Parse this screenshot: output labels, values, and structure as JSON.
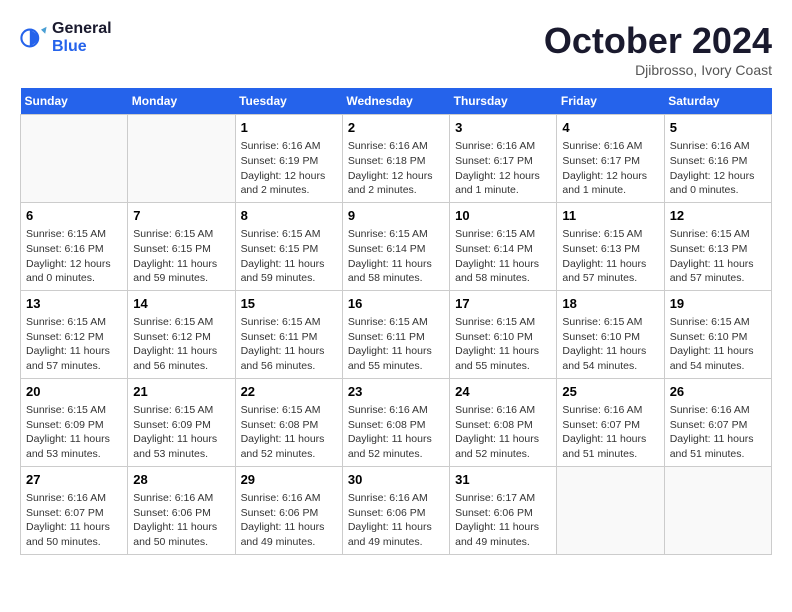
{
  "header": {
    "logo_line1": "General",
    "logo_line2": "Blue",
    "month": "October 2024",
    "location": "Djibrosso, Ivory Coast"
  },
  "days_of_week": [
    "Sunday",
    "Monday",
    "Tuesday",
    "Wednesday",
    "Thursday",
    "Friday",
    "Saturday"
  ],
  "weeks": [
    [
      {
        "day": "",
        "info": ""
      },
      {
        "day": "",
        "info": ""
      },
      {
        "day": "1",
        "info": "Sunrise: 6:16 AM\nSunset: 6:19 PM\nDaylight: 12 hours and 2 minutes."
      },
      {
        "day": "2",
        "info": "Sunrise: 6:16 AM\nSunset: 6:18 PM\nDaylight: 12 hours and 2 minutes."
      },
      {
        "day": "3",
        "info": "Sunrise: 6:16 AM\nSunset: 6:17 PM\nDaylight: 12 hours and 1 minute."
      },
      {
        "day": "4",
        "info": "Sunrise: 6:16 AM\nSunset: 6:17 PM\nDaylight: 12 hours and 1 minute."
      },
      {
        "day": "5",
        "info": "Sunrise: 6:16 AM\nSunset: 6:16 PM\nDaylight: 12 hours and 0 minutes."
      }
    ],
    [
      {
        "day": "6",
        "info": "Sunrise: 6:15 AM\nSunset: 6:16 PM\nDaylight: 12 hours and 0 minutes."
      },
      {
        "day": "7",
        "info": "Sunrise: 6:15 AM\nSunset: 6:15 PM\nDaylight: 11 hours and 59 minutes."
      },
      {
        "day": "8",
        "info": "Sunrise: 6:15 AM\nSunset: 6:15 PM\nDaylight: 11 hours and 59 minutes."
      },
      {
        "day": "9",
        "info": "Sunrise: 6:15 AM\nSunset: 6:14 PM\nDaylight: 11 hours and 58 minutes."
      },
      {
        "day": "10",
        "info": "Sunrise: 6:15 AM\nSunset: 6:14 PM\nDaylight: 11 hours and 58 minutes."
      },
      {
        "day": "11",
        "info": "Sunrise: 6:15 AM\nSunset: 6:13 PM\nDaylight: 11 hours and 57 minutes."
      },
      {
        "day": "12",
        "info": "Sunrise: 6:15 AM\nSunset: 6:13 PM\nDaylight: 11 hours and 57 minutes."
      }
    ],
    [
      {
        "day": "13",
        "info": "Sunrise: 6:15 AM\nSunset: 6:12 PM\nDaylight: 11 hours and 57 minutes."
      },
      {
        "day": "14",
        "info": "Sunrise: 6:15 AM\nSunset: 6:12 PM\nDaylight: 11 hours and 56 minutes."
      },
      {
        "day": "15",
        "info": "Sunrise: 6:15 AM\nSunset: 6:11 PM\nDaylight: 11 hours and 56 minutes."
      },
      {
        "day": "16",
        "info": "Sunrise: 6:15 AM\nSunset: 6:11 PM\nDaylight: 11 hours and 55 minutes."
      },
      {
        "day": "17",
        "info": "Sunrise: 6:15 AM\nSunset: 6:10 PM\nDaylight: 11 hours and 55 minutes."
      },
      {
        "day": "18",
        "info": "Sunrise: 6:15 AM\nSunset: 6:10 PM\nDaylight: 11 hours and 54 minutes."
      },
      {
        "day": "19",
        "info": "Sunrise: 6:15 AM\nSunset: 6:10 PM\nDaylight: 11 hours and 54 minutes."
      }
    ],
    [
      {
        "day": "20",
        "info": "Sunrise: 6:15 AM\nSunset: 6:09 PM\nDaylight: 11 hours and 53 minutes."
      },
      {
        "day": "21",
        "info": "Sunrise: 6:15 AM\nSunset: 6:09 PM\nDaylight: 11 hours and 53 minutes."
      },
      {
        "day": "22",
        "info": "Sunrise: 6:15 AM\nSunset: 6:08 PM\nDaylight: 11 hours and 52 minutes."
      },
      {
        "day": "23",
        "info": "Sunrise: 6:16 AM\nSunset: 6:08 PM\nDaylight: 11 hours and 52 minutes."
      },
      {
        "day": "24",
        "info": "Sunrise: 6:16 AM\nSunset: 6:08 PM\nDaylight: 11 hours and 52 minutes."
      },
      {
        "day": "25",
        "info": "Sunrise: 6:16 AM\nSunset: 6:07 PM\nDaylight: 11 hours and 51 minutes."
      },
      {
        "day": "26",
        "info": "Sunrise: 6:16 AM\nSunset: 6:07 PM\nDaylight: 11 hours and 51 minutes."
      }
    ],
    [
      {
        "day": "27",
        "info": "Sunrise: 6:16 AM\nSunset: 6:07 PM\nDaylight: 11 hours and 50 minutes."
      },
      {
        "day": "28",
        "info": "Sunrise: 6:16 AM\nSunset: 6:06 PM\nDaylight: 11 hours and 50 minutes."
      },
      {
        "day": "29",
        "info": "Sunrise: 6:16 AM\nSunset: 6:06 PM\nDaylight: 11 hours and 49 minutes."
      },
      {
        "day": "30",
        "info": "Sunrise: 6:16 AM\nSunset: 6:06 PM\nDaylight: 11 hours and 49 minutes."
      },
      {
        "day": "31",
        "info": "Sunrise: 6:17 AM\nSunset: 6:06 PM\nDaylight: 11 hours and 49 minutes."
      },
      {
        "day": "",
        "info": ""
      },
      {
        "day": "",
        "info": ""
      }
    ]
  ]
}
